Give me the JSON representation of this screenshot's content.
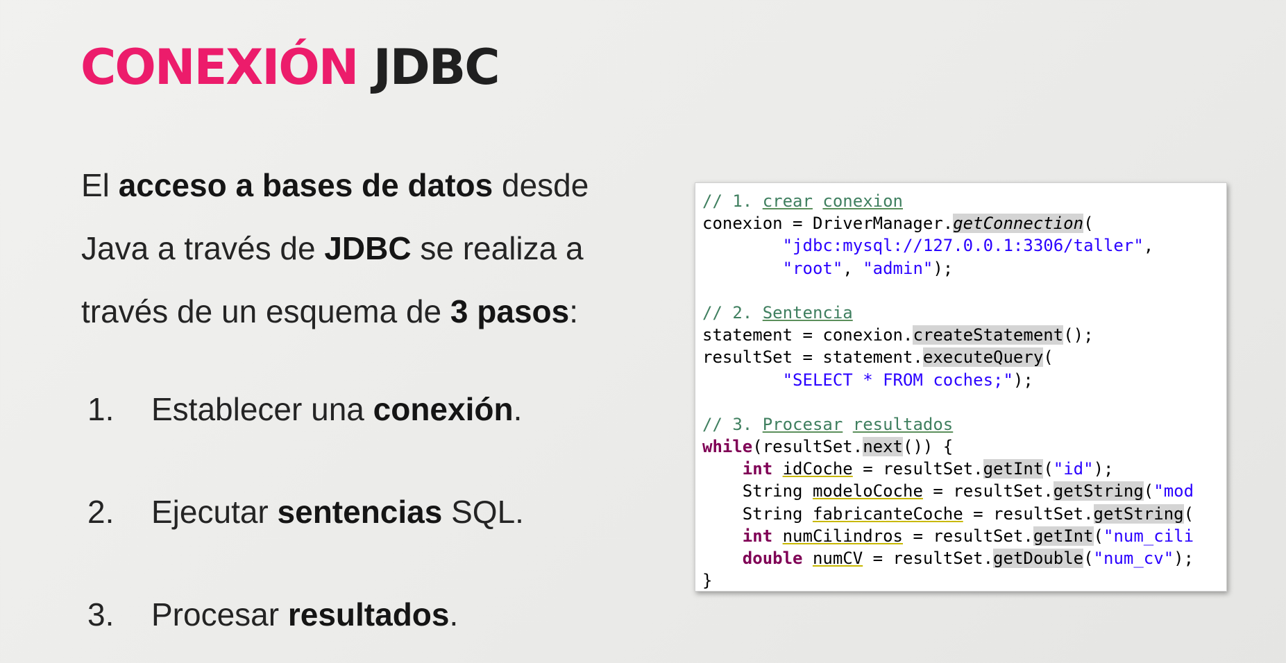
{
  "title": {
    "accent": "CONEXIÓN",
    "rest": "JDBC"
  },
  "intro": {
    "t1": "El ",
    "b1": "acceso a bases de datos",
    "t2": " desde Java a través de ",
    "b2": "JDBC",
    "t3": " se realiza a través de un esquema de ",
    "b3": "3 pasos",
    "t4": ":"
  },
  "steps": [
    {
      "num": "1.",
      "text": "Establecer una ",
      "bold": "conexión",
      "end": "."
    },
    {
      "num": "2.",
      "text": "Ejecutar ",
      "bold": "sentencias",
      "end": " SQL."
    },
    {
      "num": "3.",
      "text": "Procesar ",
      "bold": "resultados",
      "end": "."
    }
  ],
  "code": {
    "c1_prefix": "// 1. ",
    "c1_w1": "crear",
    "c1_w2": "conexion",
    "l2_a": "conexion = DriverManager.",
    "l2_method": "getConnection",
    "l2_b": "(",
    "l3_str": "\"jdbc:mysql://127.0.0.1:3306/taller\"",
    "l3_end": ",",
    "l4_str1": "\"root\"",
    "l4_sep": ", ",
    "l4_str2": "\"admin\"",
    "l4_end": ");",
    "c2_prefix": "// 2. ",
    "c2_w1": "Sentencia",
    "l7_a": "statement = conexion.",
    "l7_method": "createStatement",
    "l7_b": "();",
    "l8_a": "resultSet = statement.",
    "l8_method": "executeQuery",
    "l8_b": "(",
    "l9_str": "\"SELECT * FROM coches;\"",
    "l9_end": ");",
    "c3_prefix": "// 3. ",
    "c3_w1": "Procesar",
    "c3_w2": "resultados",
    "l12_kw": "while",
    "l12_a": "(resultSet.",
    "l12_method": "next",
    "l12_b": "()) {",
    "l13_kw": "int",
    "l13_var": "idCoche",
    "l13_a": " = resultSet.",
    "l13_method": "getInt",
    "l13_b": "(",
    "l13_str": "\"id\"",
    "l13_end": ");",
    "l14_type": "String ",
    "l14_var": "modeloCoche",
    "l14_a": " = resultSet.",
    "l14_method": "getString",
    "l14_b": "(",
    "l14_str": "\"mod",
    "l15_type": "String ",
    "l15_var": "fabricanteCoche",
    "l15_a": " = resultSet.",
    "l15_method": "getString",
    "l15_b": "(",
    "l16_kw": "int",
    "l16_var": "numCilindros",
    "l16_a": " = resultSet.",
    "l16_method": "getInt",
    "l16_b": "(",
    "l16_str": "\"num_cili",
    "l17_kw": "double",
    "l17_var": "numCV",
    "l17_a": " = resultSet.",
    "l17_method": "getDouble",
    "l17_b": "(",
    "l17_str": "\"num_cv\"",
    "l17_end": ");",
    "l18": "}"
  },
  "colors": {
    "accent": "#ec1c6b",
    "comment": "#3f7f5f",
    "string": "#2a00ff",
    "keyword": "#7f0055"
  }
}
